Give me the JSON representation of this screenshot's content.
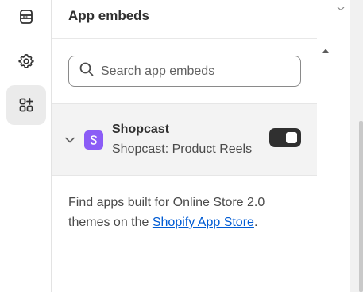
{
  "rail": {
    "items": [
      {
        "name": "sections",
        "icon": "layout-sections-icon"
      },
      {
        "name": "settings",
        "icon": "gear-icon"
      },
      {
        "name": "app-embeds",
        "icon": "apps-add-icon",
        "active": true
      }
    ]
  },
  "panel": {
    "title": "App embeds",
    "search": {
      "placeholder": "Search app embeds",
      "value": ""
    },
    "embed": {
      "name": "Shopcast",
      "description": "Shopcast: Product Reels",
      "icon_color": "#8b5cf6",
      "enabled": true
    },
    "help": {
      "text_before": "Find apps built for Online Store 2.0 themes on the ",
      "link_text": "Shopify App Store",
      "text_after": "."
    }
  },
  "colors": {
    "accent_link": "#005bd3",
    "toggle_on": "#303030",
    "active_rail_bg": "#ebebeb"
  }
}
